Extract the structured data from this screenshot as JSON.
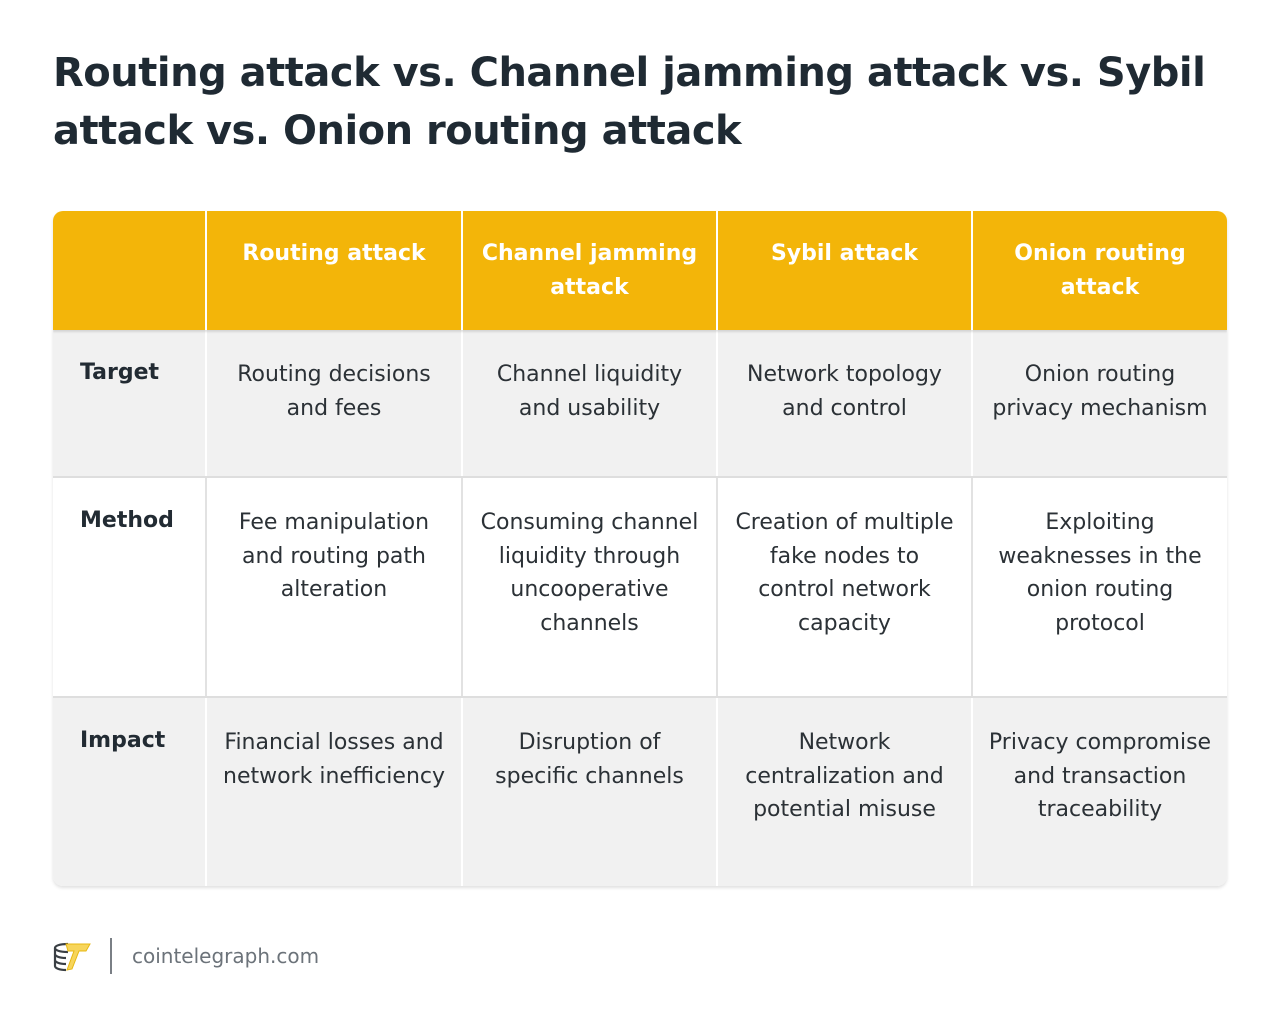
{
  "title": "Routing attack vs. Channel jamming attack vs. Sybil attack vs. Onion routing attack",
  "table": {
    "columns": [
      "",
      "Routing attack",
      "Channel jamming attack",
      "Sybil attack",
      "Onion routing attack"
    ],
    "rows": [
      {
        "label": "Target",
        "cells": [
          "Routing decisions and fees",
          "Channel liquidity and usability",
          "Network topology and control",
          "Onion routing privacy mechanism"
        ]
      },
      {
        "label": "Method",
        "cells": [
          "Fee manipulation and routing path alteration",
          "Consuming channel liquidity through uncooperative channels",
          "Creation of multiple fake nodes to control network capacity",
          "Exploiting weaknesses in the onion routing protocol"
        ]
      },
      {
        "label": "Impact",
        "cells": [
          "Financial losses and network inefficiency",
          "Disruption of specific channels",
          "Network centralization and potential misuse",
          "Privacy compromise and transaction traceability"
        ]
      }
    ]
  },
  "footer": {
    "logo_icon": "cointelegraph-logo-icon",
    "site": "cointelegraph.com"
  },
  "colors": {
    "header_bg": "#f3b509",
    "header_text": "#ffffff",
    "row_gray": "#f1f1f1",
    "row_white": "#ffffff",
    "title_text": "#1f2a33"
  }
}
